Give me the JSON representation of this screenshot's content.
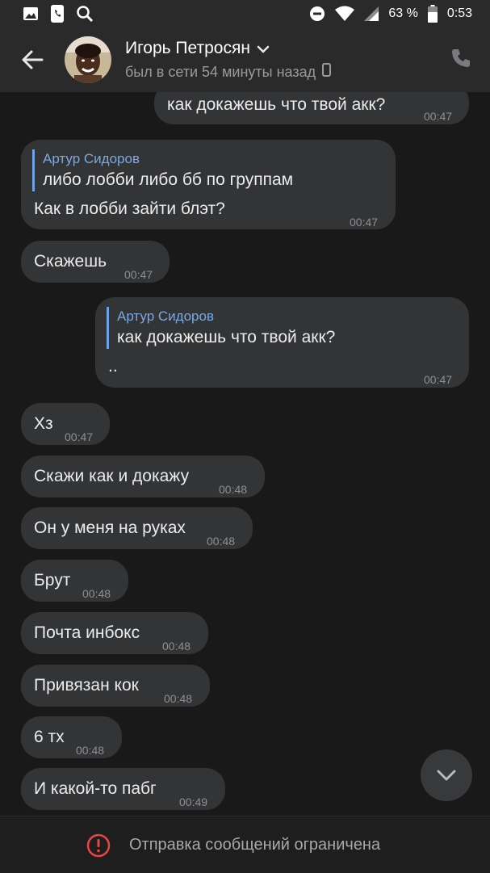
{
  "status_bar": {
    "battery": "63 %",
    "time": "0:53",
    "icons": [
      "image-icon",
      "phone-icon",
      "search-icon",
      "dnd-icon",
      "wifi-icon",
      "signal-icon",
      "battery-icon"
    ]
  },
  "header": {
    "name": "Игорь Петросян",
    "status": "был в сети 54 минуты назад"
  },
  "messages": [
    {
      "side": "out",
      "text": "как докажешь что твой акк?",
      "time": "00:47"
    },
    {
      "side": "in",
      "reply_name": "Артур Сидоров",
      "reply_text": "либо лобби либо бб по группам",
      "text": "Как в лобби зайти блэт?",
      "time": "00:47"
    },
    {
      "side": "in",
      "text": "Скажешь",
      "time": "00:47"
    },
    {
      "side": "out",
      "reply_name": "Артур Сидоров",
      "reply_text": "как докажешь что твой акк?",
      "text": "..",
      "time": "00:47"
    },
    {
      "side": "in",
      "text": "Хз",
      "time": "00:47"
    },
    {
      "side": "in",
      "text": "Скажи как и докажу",
      "time": "00:48"
    },
    {
      "side": "in",
      "text": "Он у меня на руках",
      "time": "00:48"
    },
    {
      "side": "in",
      "text": "Брут",
      "time": "00:48"
    },
    {
      "side": "in",
      "text": "Почта инбокс",
      "time": "00:48"
    },
    {
      "side": "in",
      "text": "Привязан кок",
      "time": "00:48"
    },
    {
      "side": "in",
      "text": "6 тх",
      "time": "00:48"
    },
    {
      "side": "in",
      "text": "И какой-то пабг",
      "time": "00:49"
    }
  ],
  "footer": {
    "notice": "Отправка сообщений ограничена"
  },
  "colors": {
    "background": "#19191a",
    "bubble": "#333436",
    "accent": "#6ea2e8",
    "warning": "#e64646"
  }
}
